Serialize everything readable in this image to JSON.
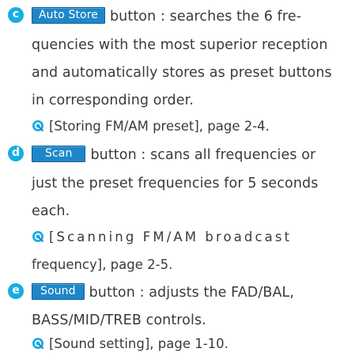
{
  "colors": {
    "marker": "#17aee2",
    "button": "#1f87c9",
    "text": "#3a3a3a"
  },
  "items": [
    {
      "marker": "c",
      "button": "Auto Store",
      "lines": [
        "button : searches the 6 fre-",
        "quencies with the most superior reception",
        "and automatically stores as preset buttons",
        "in corresponding order."
      ],
      "ref": [
        "[Storing FM/AM preset], page 2-4."
      ]
    },
    {
      "marker": "d",
      "button": "Scan",
      "lines": [
        "button : scans all frequencies or",
        "just the preset frequencies for 5 seconds",
        "each."
      ],
      "ref": [
        "[Scanning FM/AM broadcast",
        "frequency], page 2-5."
      ]
    },
    {
      "marker": "e",
      "button": "Sound",
      "lines": [
        "button : adjusts the FAD/BAL,",
        "BASS/MID/TREB controls."
      ],
      "ref": [
        "[Sound setting], page 1-10."
      ]
    }
  ]
}
